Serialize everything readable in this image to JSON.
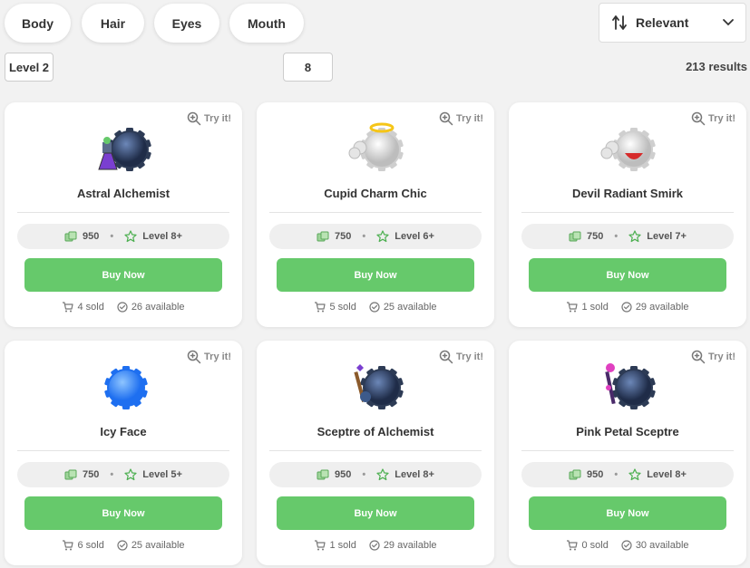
{
  "filters": [
    "Body",
    "Hair",
    "Eyes",
    "Mouth"
  ],
  "sort": {
    "label": "Relevant"
  },
  "level_filter": {
    "value": "Level 2"
  },
  "number_input": {
    "value": "8"
  },
  "results_text": "213 results",
  "try_label": "Try it!",
  "buy_label": "Buy Now",
  "colors": {
    "buy_button": "#66c96b",
    "background": "#f2f2f2"
  },
  "items": [
    {
      "name": "Astral Alchemist",
      "price": "950",
      "level": "Level 8+",
      "sold": "4 sold",
      "available": "26 available",
      "icon": "astral-alchemist-icon"
    },
    {
      "name": "Cupid Charm Chic",
      "price": "750",
      "level": "Level 6+",
      "sold": "5 sold",
      "available": "25 available",
      "icon": "cupid-charm-icon"
    },
    {
      "name": "Devil Radiant Smirk",
      "price": "750",
      "level": "Level 7+",
      "sold": "1 sold",
      "available": "29 available",
      "icon": "devil-smirk-icon"
    },
    {
      "name": "Icy Face",
      "price": "750",
      "level": "Level 5+",
      "sold": "6 sold",
      "available": "25 available",
      "icon": "icy-face-icon"
    },
    {
      "name": "Sceptre of Alchemist",
      "price": "950",
      "level": "Level 8+",
      "sold": "1 sold",
      "available": "29 available",
      "icon": "sceptre-alchemist-icon"
    },
    {
      "name": "Pink Petal Sceptre",
      "price": "950",
      "level": "Level 8+",
      "sold": "0 sold",
      "available": "30 available",
      "icon": "pink-petal-sceptre-icon"
    }
  ]
}
